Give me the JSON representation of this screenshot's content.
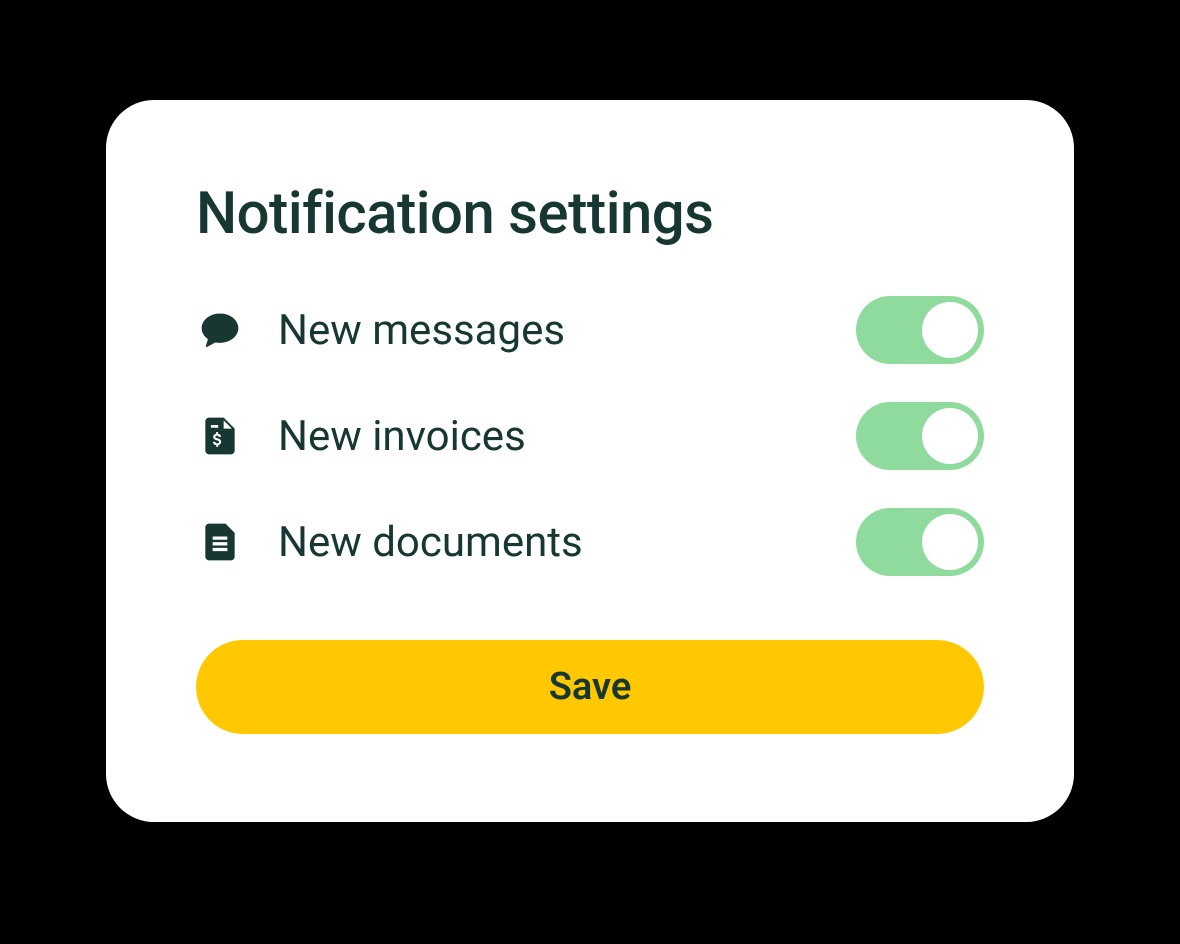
{
  "title": "Notification settings",
  "settings": [
    {
      "label": "New messages",
      "icon": "message",
      "enabled": true
    },
    {
      "label": "New invoices",
      "icon": "invoice",
      "enabled": true
    },
    {
      "label": "New documents",
      "icon": "document",
      "enabled": true
    }
  ],
  "actions": {
    "save_label": "Save"
  },
  "colors": {
    "text": "#163732",
    "toggle_on": "#8edb9d",
    "button": "#ffc800",
    "card_bg": "#ffffff",
    "page_bg": "#000000"
  }
}
